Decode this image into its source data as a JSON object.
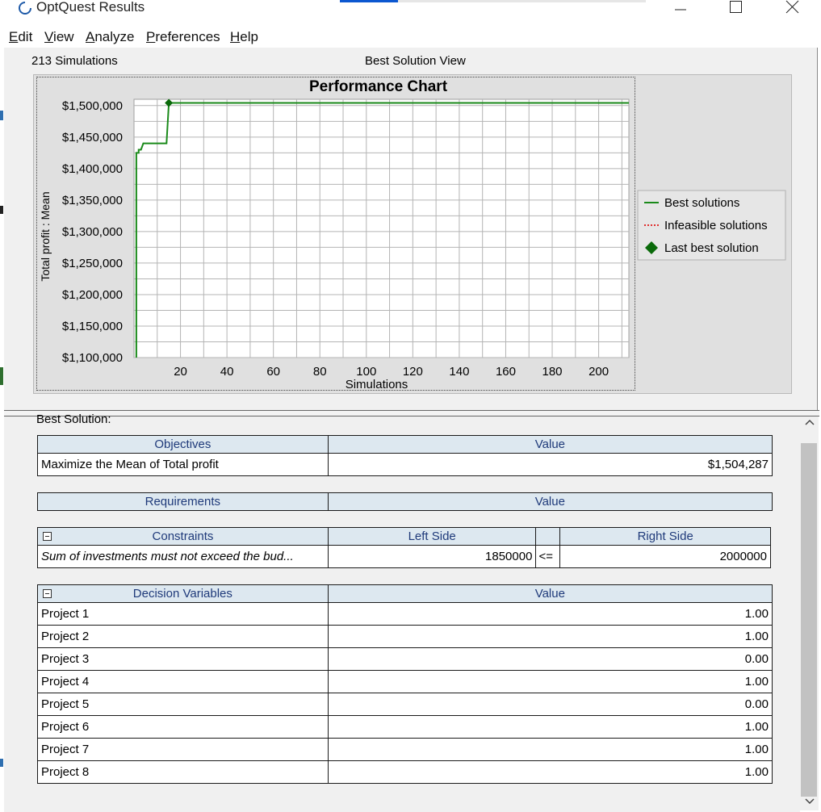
{
  "window": {
    "title": "OptQuest Results"
  },
  "menu": [
    {
      "acc": "E",
      "rest": "dit"
    },
    {
      "acc": "V",
      "rest": "iew"
    },
    {
      "acc": "A",
      "rest": "nalyze"
    },
    {
      "acc": "P",
      "rest": "references"
    },
    {
      "acc": "H",
      "rest": "elp"
    }
  ],
  "header": {
    "simulations": "213 Simulations",
    "view": "Best Solution View"
  },
  "colors": {
    "best_line": "#1a8a1a",
    "infeasible_line": "#e03030",
    "header_bg": "#dde8f0",
    "header_text": "#1f3a7a"
  },
  "chart_data": {
    "type": "line",
    "title": "Performance Chart",
    "xlabel": "Simulations",
    "ylabel": "Total profit : Mean",
    "xlim": [
      0,
      213
    ],
    "ylim": [
      1100000,
      1510000
    ],
    "x_ticks": [
      20,
      40,
      60,
      80,
      100,
      120,
      140,
      160,
      180,
      200
    ],
    "y_ticks": [
      1100000,
      1150000,
      1200000,
      1250000,
      1300000,
      1350000,
      1400000,
      1450000,
      1500000
    ],
    "y_tick_labels": [
      "$1,100,000",
      "$1,150,000",
      "$1,200,000",
      "$1,250,000",
      "$1,300,000",
      "$1,350,000",
      "$1,400,000",
      "$1,450,000",
      "$1,500,000"
    ],
    "grid": true,
    "legend_position": "right",
    "series": [
      {
        "name": "Best solutions",
        "style": "solid",
        "points": [
          [
            1,
            1100000
          ],
          [
            1,
            1425000
          ],
          [
            2,
            1425000
          ],
          [
            2,
            1430000
          ],
          [
            3,
            1430000
          ],
          [
            4,
            1440000
          ],
          [
            14,
            1440000
          ],
          [
            15,
            1504287
          ],
          [
            213,
            1504287
          ]
        ]
      },
      {
        "name": "Infeasible solutions",
        "style": "dotted",
        "points": []
      }
    ],
    "markers": [
      {
        "name": "Last best solution",
        "shape": "diamond",
        "x": 15,
        "y": 1504287
      }
    ]
  },
  "best_solution": {
    "label": "Best Solution:",
    "objectives": {
      "header": "Objectives",
      "value_header": "Value",
      "rows": [
        {
          "name": "Maximize the Mean of Total profit",
          "value": "$1,504,287"
        }
      ]
    },
    "requirements": {
      "header": "Requirements",
      "value_header": "Value"
    },
    "constraints": {
      "header": "Constraints",
      "left_header": "Left Side",
      "right_header": "Right Side",
      "rows": [
        {
          "name": "Sum of investments must not exceed the bud...",
          "left": "1850000",
          "op": "<=",
          "right": "2000000"
        }
      ]
    },
    "decision_variables": {
      "header": "Decision Variables",
      "value_header": "Value",
      "rows": [
        {
          "name": "Project 1",
          "value": "1.00"
        },
        {
          "name": "Project 2",
          "value": "1.00"
        },
        {
          "name": "Project 3",
          "value": "0.00"
        },
        {
          "name": "Project 4",
          "value": "1.00"
        },
        {
          "name": "Project 5",
          "value": "0.00"
        },
        {
          "name": "Project 6",
          "value": "1.00"
        },
        {
          "name": "Project 7",
          "value": "1.00"
        },
        {
          "name": "Project 8",
          "value": "1.00"
        }
      ]
    }
  }
}
